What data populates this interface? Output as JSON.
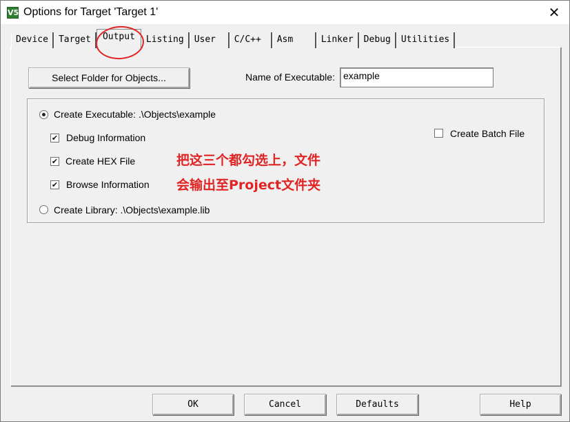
{
  "window": {
    "title": "Options for Target 'Target 1'",
    "icon": "V5",
    "close_symbol": "✕"
  },
  "tabs": [
    {
      "label": "Device"
    },
    {
      "label": "Target"
    },
    {
      "label": "Output",
      "active": true
    },
    {
      "label": "Listing"
    },
    {
      "label": "User"
    },
    {
      "label": "C/C++"
    },
    {
      "label": "Asm"
    },
    {
      "label": "Linker"
    },
    {
      "label": "Debug"
    },
    {
      "label": "Utilities"
    }
  ],
  "output": {
    "select_folder_label": "Select Folder for Objects...",
    "name_executable_label": "Name of Executable:",
    "name_executable_value": "example",
    "create_executable_label": "Create Executable:  .\\Objects\\example",
    "create_executable_checked": true,
    "debug_info_label": "Debug Information",
    "debug_info_checked": true,
    "create_hex_label": "Create HEX File",
    "create_hex_checked": true,
    "browse_info_label": "Browse Information",
    "browse_info_checked": true,
    "create_library_label": "Create Library:  .\\Objects\\example.lib",
    "create_library_checked": false,
    "create_batch_label": "Create Batch File",
    "create_batch_checked": false,
    "check_mark": "✔"
  },
  "annotation": {
    "line1": "把这三个都勾选上，文件",
    "line2": "会输出至Project文件夹",
    "color": "#e02424"
  },
  "footer": {
    "ok_label": "OK",
    "cancel_label": "Cancel",
    "defaults_label": "Defaults",
    "help_label": "Help"
  }
}
